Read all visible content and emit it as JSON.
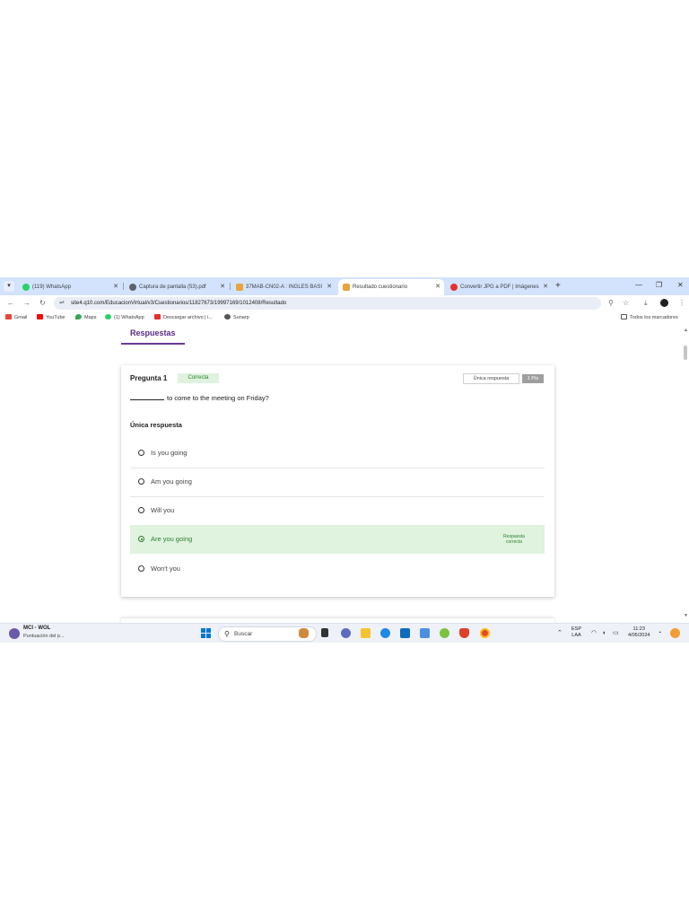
{
  "browser": {
    "tabs": [
      {
        "label": "(119) WhatsApp",
        "icon": "whatsapp-icon",
        "active": false
      },
      {
        "label": "Captura de pantalla (53).pdf",
        "icon": "globe-icon",
        "active": false
      },
      {
        "label": "37MAB-CN02-A : INGLES BASI",
        "icon": "q10-icon",
        "active": false
      },
      {
        "label": "Resultado cuestionario",
        "icon": "q10-icon",
        "active": true
      },
      {
        "label": "Convertir JPG a PDF | Imágenes",
        "icon": "ilovepdf-icon",
        "active": false
      }
    ],
    "url": "site4.q10.com/EducacionVirtual/v3/Cuestionarios/11827673/19997169/1012408/Resultado",
    "bookmarks": [
      {
        "label": "Gmail",
        "color": "#ea4335"
      },
      {
        "label": "YouTube",
        "color": "#ff0000"
      },
      {
        "label": "Maps",
        "color": "#34a853"
      },
      {
        "label": "(1) WhatsApp",
        "color": "#25d366"
      },
      {
        "label": "Descargar archivo | i...",
        "color": "#e5322d"
      },
      {
        "label": "Sunarp",
        "color": "#555555"
      }
    ],
    "all_bookmarks": "Todos los marcadores"
  },
  "page": {
    "section_title": "Respuestas",
    "question": {
      "title": "Pregunta 1",
      "status": "Correcta",
      "type_badge": "Única respuesta",
      "points": "1 Pts",
      "text": "to come to the meeting on Friday?",
      "type_label": "Única respuesta",
      "options": [
        {
          "text": "Is you going",
          "selected": false
        },
        {
          "text": "Am you going",
          "selected": false
        },
        {
          "text": "Will you",
          "selected": false
        },
        {
          "text": "Are you going",
          "selected": true,
          "tag": "Respuesta correcta"
        },
        {
          "text": "Won't you",
          "selected": false
        }
      ]
    }
  },
  "taskbar": {
    "weather_title": "MCI - WOL",
    "weather_subtitle": "Puntuación del p...",
    "search_placeholder": "Buscar",
    "language": "ESP",
    "region": "LAA",
    "time": "11:23",
    "date": "4/05/2024"
  },
  "colors": {
    "accent": "#5b2c83",
    "correct_bg": "#dff3de",
    "correct_text": "#2e7d32",
    "tabstrip": "#d3e3fd"
  }
}
